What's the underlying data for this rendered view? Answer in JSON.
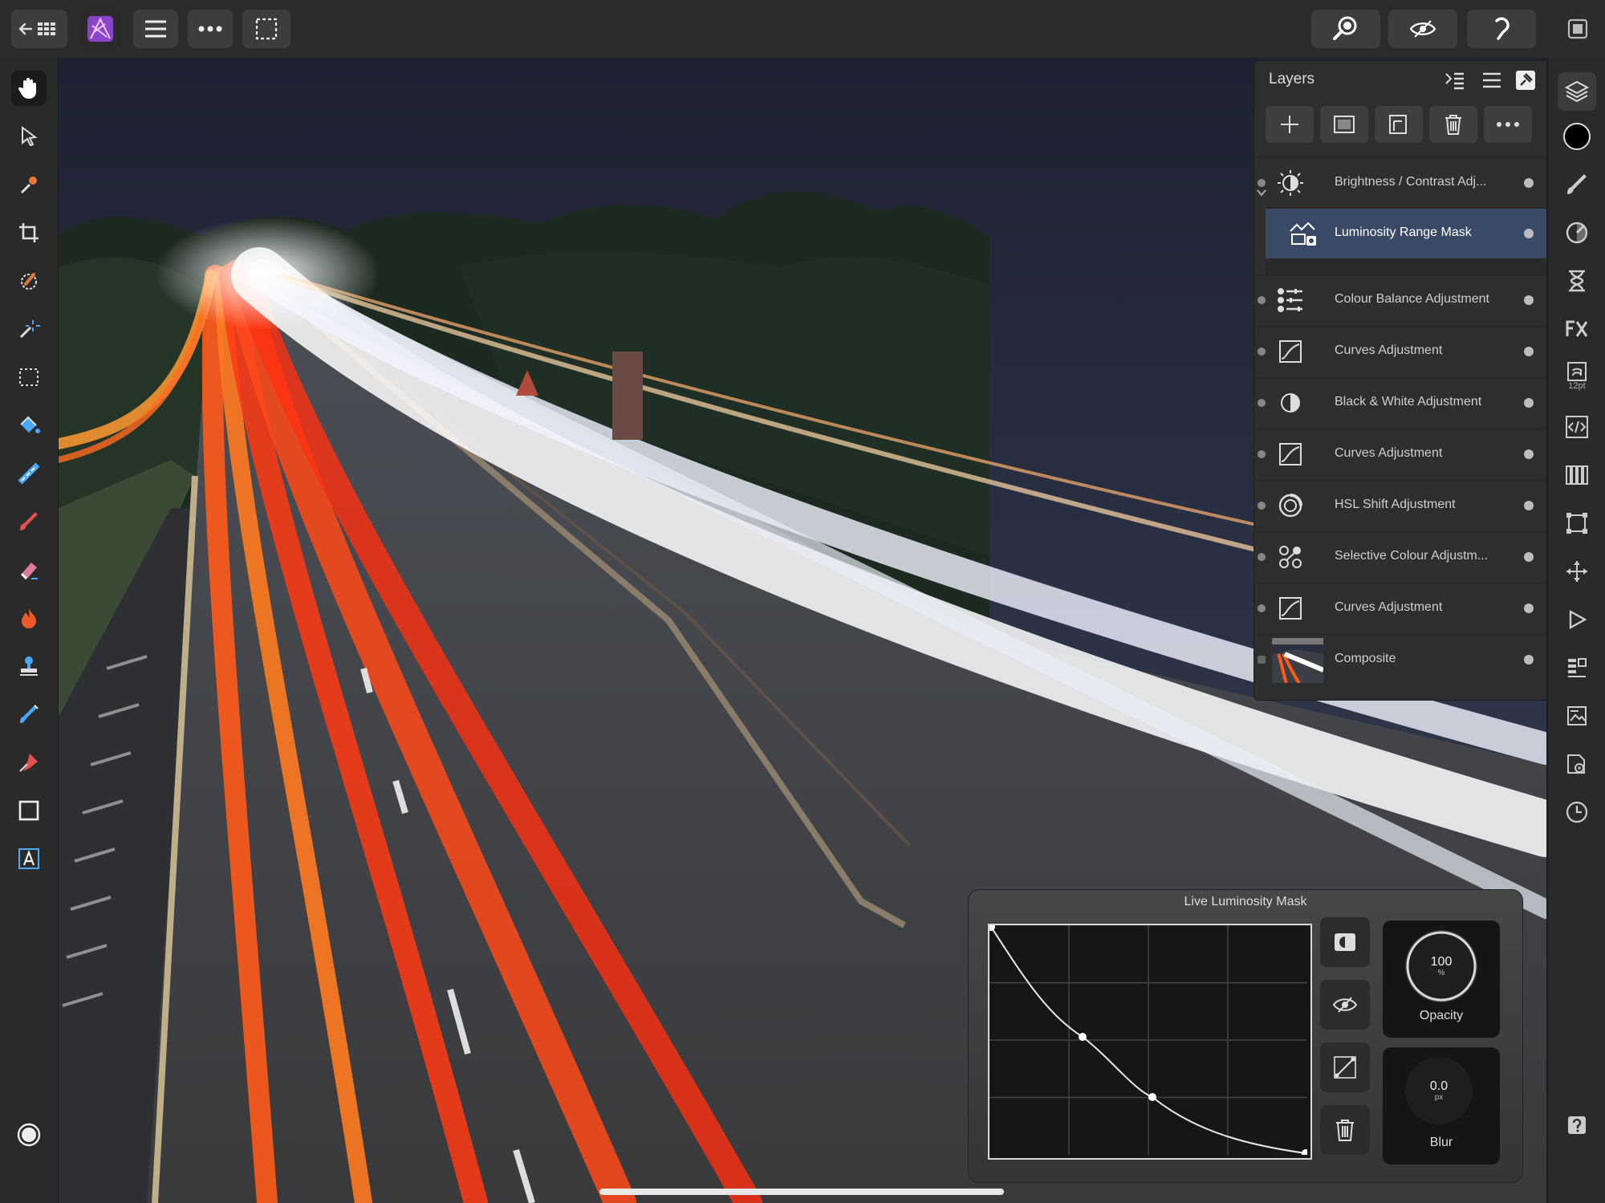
{
  "app": {
    "name": "Affinity Photo"
  },
  "toolbar": {
    "left_buttons": [
      "back-to-gallery",
      "persona",
      "menu",
      "more",
      "selection"
    ],
    "right_buttons": [
      "zoom",
      "view-quality",
      "snapping"
    ]
  },
  "tools": [
    {
      "name": "hand-tool"
    },
    {
      "name": "move-tool"
    },
    {
      "name": "color-picker-tool"
    },
    {
      "name": "crop-tool"
    },
    {
      "name": "selection-brush-tool"
    },
    {
      "name": "magic-wand-tool"
    },
    {
      "name": "rectangular-marquee-tool"
    },
    {
      "name": "flood-fill-tool"
    },
    {
      "name": "gradient-tool"
    },
    {
      "name": "paint-brush-tool"
    },
    {
      "name": "erase-brush-tool"
    },
    {
      "name": "dodge-tool"
    },
    {
      "name": "clone-stamp-tool"
    },
    {
      "name": "healing-brush-tool"
    },
    {
      "name": "pen-tool"
    },
    {
      "name": "rectangle-tool"
    },
    {
      "name": "artistic-text-tool"
    }
  ],
  "layers_panel": {
    "title": "Layers",
    "layers": [
      {
        "name": "Brightness / Contrast Adj...",
        "icon": "brightness-contrast-icon",
        "selected": false
      },
      {
        "name": "Luminosity Range Mask",
        "icon": "luminosity-mask-icon",
        "selected": true
      },
      {
        "name": "Colour Balance Adjustment",
        "icon": "colour-balance-icon",
        "selected": false
      },
      {
        "name": "Curves Adjustment",
        "icon": "curves-icon",
        "selected": false
      },
      {
        "name": "Black & White Adjustment",
        "icon": "black-white-icon",
        "selected": false
      },
      {
        "name": "Curves Adjustment",
        "icon": "curves-icon",
        "selected": false
      },
      {
        "name": "HSL Shift Adjustment",
        "icon": "hsl-icon",
        "selected": false
      },
      {
        "name": "Selective Colour Adjustm...",
        "icon": "selective-colour-icon",
        "selected": false
      },
      {
        "name": "Curves Adjustment",
        "icon": "curves-icon",
        "selected": false
      },
      {
        "name": "Composite",
        "icon": "image-thumbnail",
        "selected": false
      }
    ]
  },
  "luminosity_mask": {
    "title": "Live Luminosity Mask",
    "opacity": {
      "value": "100",
      "unit": "%",
      "label": "Opacity"
    },
    "blur": {
      "value": "0.0",
      "unit": "px",
      "label": "Blur"
    }
  },
  "studio": {
    "text_size": "12pt"
  },
  "colors": {
    "selected_layer": "#3a4a66",
    "accent": "#9b59d0",
    "panel_bg": "#2e2e2e"
  }
}
